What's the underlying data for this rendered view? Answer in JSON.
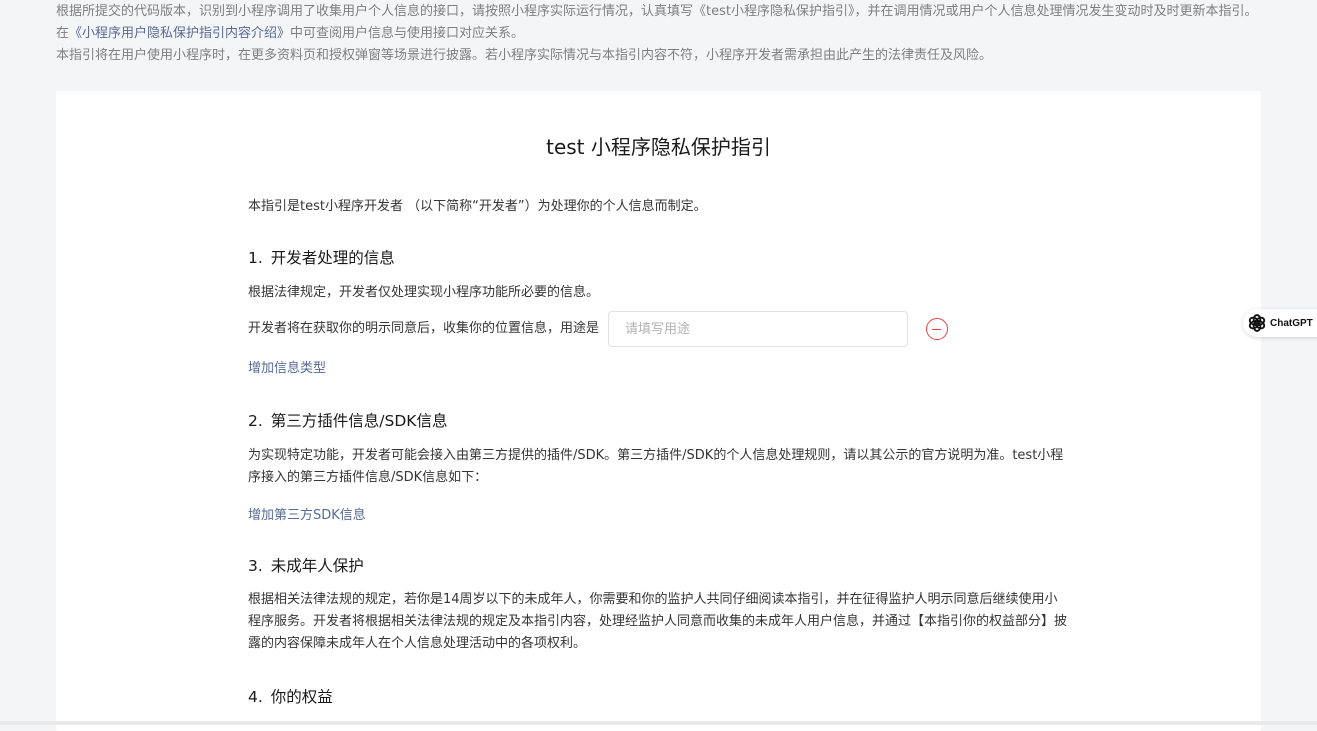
{
  "notice": {
    "line1": "根据所提交的代码版本，识别到小程序调用了收集用户个人信息的接口，请按照小程序实际运行情况，认真填写《test小程序隐私保护指引》，并在调用情况或用户个人信息处理情况发生变动时及时更新本指引。 在",
    "link": "《小程序用户隐私保护指引内容介绍》",
    "line1_after": "中可查阅用户信息与使用接口对应关系。",
    "line2": "本指引将在用户使用小程序时，在更多资料页和授权弹窗等场景进行披露。若小程序实际情况与本指引内容不符，小程序开发者需承担由此产生的法律责任及风险。"
  },
  "document": {
    "title": "test 小程序隐私保护指引",
    "intro": "本指引是test小程序开发者 （以下简称“开发者”）为处理你的个人信息而制定。",
    "sections": [
      {
        "num": "1.",
        "heading": "开发者处理的信息",
        "text": "根据法律规定，开发者仅处理实现小程序功能所必要的信息。",
        "row_label": "开发者将在获取你的明示同意后，收集你的位置信息，用途是",
        "input_placeholder": "请填写用途",
        "input_value": "",
        "add_link": "增加信息类型"
      },
      {
        "num": "2.",
        "heading": "第三方插件信息/SDK信息",
        "text": "为实现特定功能，开发者可能会接入由第三方提供的插件/SDK。第三方插件/SDK的个人信息处理规则，请以其公示的官方说明为准。test小程序接入的第三方插件信息/SDK信息如下：",
        "add_link": "增加第三方SDK信息"
      },
      {
        "num": "3.",
        "heading": "未成年人保护",
        "text": "根据相关法律法规的规定，若你是14周岁以下的未成年人，你需要和你的监护人共同仔细阅读本指引，并在征得监护人明示同意后继续使用小程序服务。开发者将根据相关法律法规的规定及本指引内容，处理经监护人同意而收集的未成年人用户信息，并通过【本指引你的权益部分】披露的内容保障未成年人在个人信息处理活动中的各项权利。"
      },
      {
        "num": "4.",
        "heading": "你的权益"
      }
    ]
  },
  "extension": {
    "label": "ChatGPT",
    "icon": "openai-logo-icon"
  },
  "colors": {
    "link": "#576b95",
    "danger": "#e64340",
    "notice_text": "#7f7f7f",
    "background": "#f4f5f7"
  }
}
